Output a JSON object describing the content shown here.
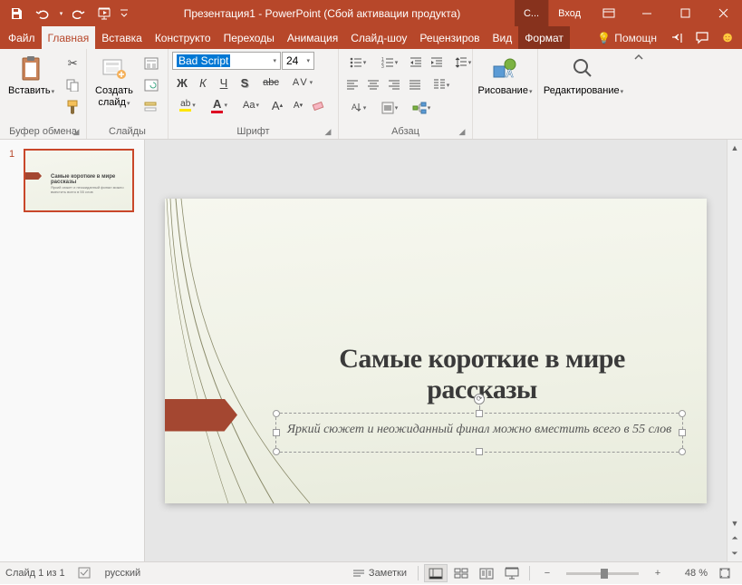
{
  "title": "Презентация1 - PowerPoint (Сбой активации продукта)",
  "account": {
    "label": "Вход",
    "badge": "С..."
  },
  "tabs": {
    "file": "Файл",
    "items": [
      "Главная",
      "Вставка",
      "Конструкто",
      "Переходы",
      "Анимация",
      "Слайд-шоу",
      "Рецензиров",
      "Вид",
      "Формат"
    ],
    "active": 0,
    "help": "Помощн"
  },
  "ribbon": {
    "clipboard": {
      "label": "Буфер обмена",
      "paste": "Вставить"
    },
    "slides": {
      "label": "Слайды",
      "new_slide": "Создать\nслайд"
    },
    "font": {
      "label": "Шрифт",
      "name": "Bad Script",
      "size": "24"
    },
    "paragraph": {
      "label": "Абзац"
    },
    "drawing": {
      "label": "Рисование"
    },
    "editing": {
      "label": "Редактирование"
    }
  },
  "thumbnails": [
    {
      "num": "1",
      "title": "Самые короткие в мире",
      "title2": "рассказы",
      "sub": "Яркий сюжет и неожиданный финал можно вместить всего в 55 слов"
    }
  ],
  "slide": {
    "title": "Самые короткие в мире рассказы",
    "subtitle": "Яркий сюжет и неожиданный финал можно вместить всего в 55 слов"
  },
  "status": {
    "slide_count": "Слайд 1 из 1",
    "language": "русский",
    "notes": "Заметки",
    "zoom": "48 %"
  }
}
